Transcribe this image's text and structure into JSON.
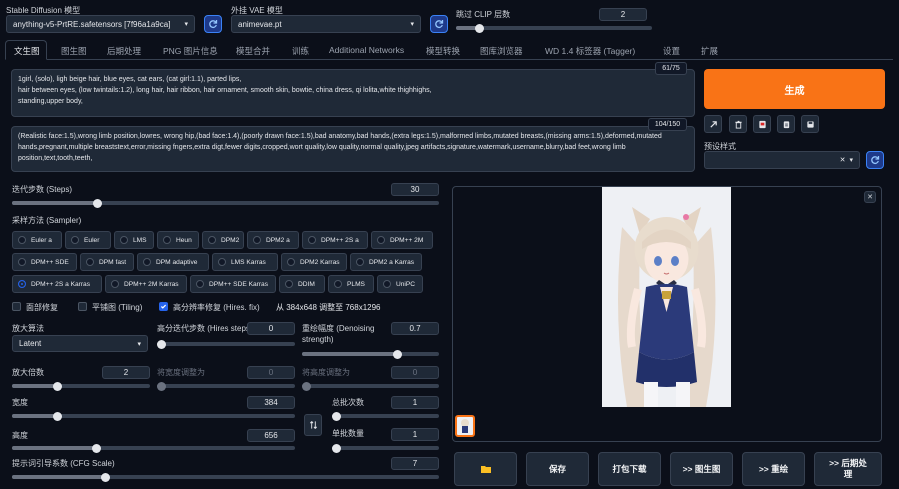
{
  "top": {
    "model_label": "Stable Diffusion 模型",
    "model_value": "anything-v5-PrtRE.safetensors [7f96a1a9ca]",
    "vae_label": "外挂 VAE 模型",
    "vae_value": "animevae.pt",
    "clip_label": "跳过 CLIP 层数",
    "clip_value": "2",
    "clip_level": 0.12
  },
  "tabs": [
    "文生图",
    "图生图",
    "后期处理",
    "PNG 图片信息",
    "模型合并",
    "训练",
    "Additional Networks",
    "模型转换",
    "图库浏览器",
    "WD 1.4 标签器 (Tagger)",
    "设置",
    "扩展"
  ],
  "prompt": {
    "text": "1girl, (solo), ligh beige hair, blue eyes, cat ears, (cat girl:1.1), parted lips,\nhair between eyes, (low twintails:1.2), long hair, hair ribbon, hair ornament, smooth skin, bowtie, china dress, qi lolita,white thighhighs,\nstanding,upper body,",
    "counter": "61/75"
  },
  "negative": {
    "text": "(Realistic face:1.5),wrong limb position,lowres, wrong hip,(bad face:1.4),(poorly drawn face:1.5),bad anatomy,bad hands,(extra legs:1.5),malformed limbs,mutated breasts,(missing arms:1.5),deformed,mutated hands,pregnant,multiple breaststext,error,missing fngers,extra digt,fewer digits,cropped,wort quality,low quality,normal quality,jpeg artifacts,signature,watermark,username,blurry,bad feet,wrong limb position,text,tooth,teeth,",
    "counter": "104/150"
  },
  "generate_label": "生成",
  "styles_label": "预设样式",
  "steps": {
    "label": "迭代步数 (Steps)",
    "value": "30",
    "level": 0.2
  },
  "sampler": {
    "label": "采样方法 (Sampler)",
    "options": [
      "Euler a",
      "Euler",
      "LMS",
      "Heun",
      "DPM2",
      "DPM2 a",
      "DPM++ 2S a",
      "DPM++ 2M",
      "DPM++ SDE",
      "DPM fast",
      "DPM adaptive",
      "LMS Karras",
      "DPM2 Karras",
      "DPM2 a Karras",
      "DPM++ 2S a Karras",
      "DPM++ 2M Karras",
      "DPM++ SDE Karras",
      "DDIM",
      "PLMS",
      "UniPC"
    ],
    "selected": "DPM++ 2S a Karras"
  },
  "checks": {
    "restore_faces": "面部修复",
    "tiling": "平铺图 (Tiling)",
    "hires_fix": "高分辨率修复 (Hires. fix)",
    "resize_info": "从 384x648 调整至 768x1296"
  },
  "hires": {
    "upscaler_label": "放大算法",
    "upscaler_value": "Latent",
    "hires_steps_label": "高分迭代步数 (Hires steps)",
    "hires_steps_value": "0",
    "hires_steps_level": 0.0,
    "denoise_label": "重绘幅度 (Denoising strength)",
    "denoise_value": "0.7",
    "denoise_level": 0.7,
    "scale_label": "放大倍数",
    "scale_value": "2",
    "scale_level": 0.33,
    "resize_w_label": "将宽度调整为",
    "resize_w_value": "0",
    "resize_w_level": 0.0,
    "resize_h_label": "将高度调整为",
    "resize_h_value": "0",
    "resize_h_level": 0.0
  },
  "dims": {
    "width_label": "宽度",
    "width_value": "384",
    "width_level": 0.16,
    "height_label": "高度",
    "height_value": "656",
    "height_level": 0.3,
    "batch_count_label": "总批次数",
    "batch_count_value": "1",
    "batch_count_level": 0.0,
    "batch_size_label": "单批数量",
    "batch_size_value": "1",
    "batch_size_level": 0.0,
    "swap_icon": "swap-icon"
  },
  "cfg": {
    "label": "提示词引导系数 (CFG Scale)",
    "value": "7",
    "level": 0.22
  },
  "output_buttons": {
    "folder_icon": "folder-icon",
    "save": "保存",
    "zip": "打包下载",
    "to_img2img": ">> 图生图",
    "to_inpaint": ">> 重绘",
    "to_extras": ">> 后期处理"
  },
  "colors": {
    "accent": "#f97316",
    "primary": "#2563eb",
    "background": "#0b0f19"
  }
}
